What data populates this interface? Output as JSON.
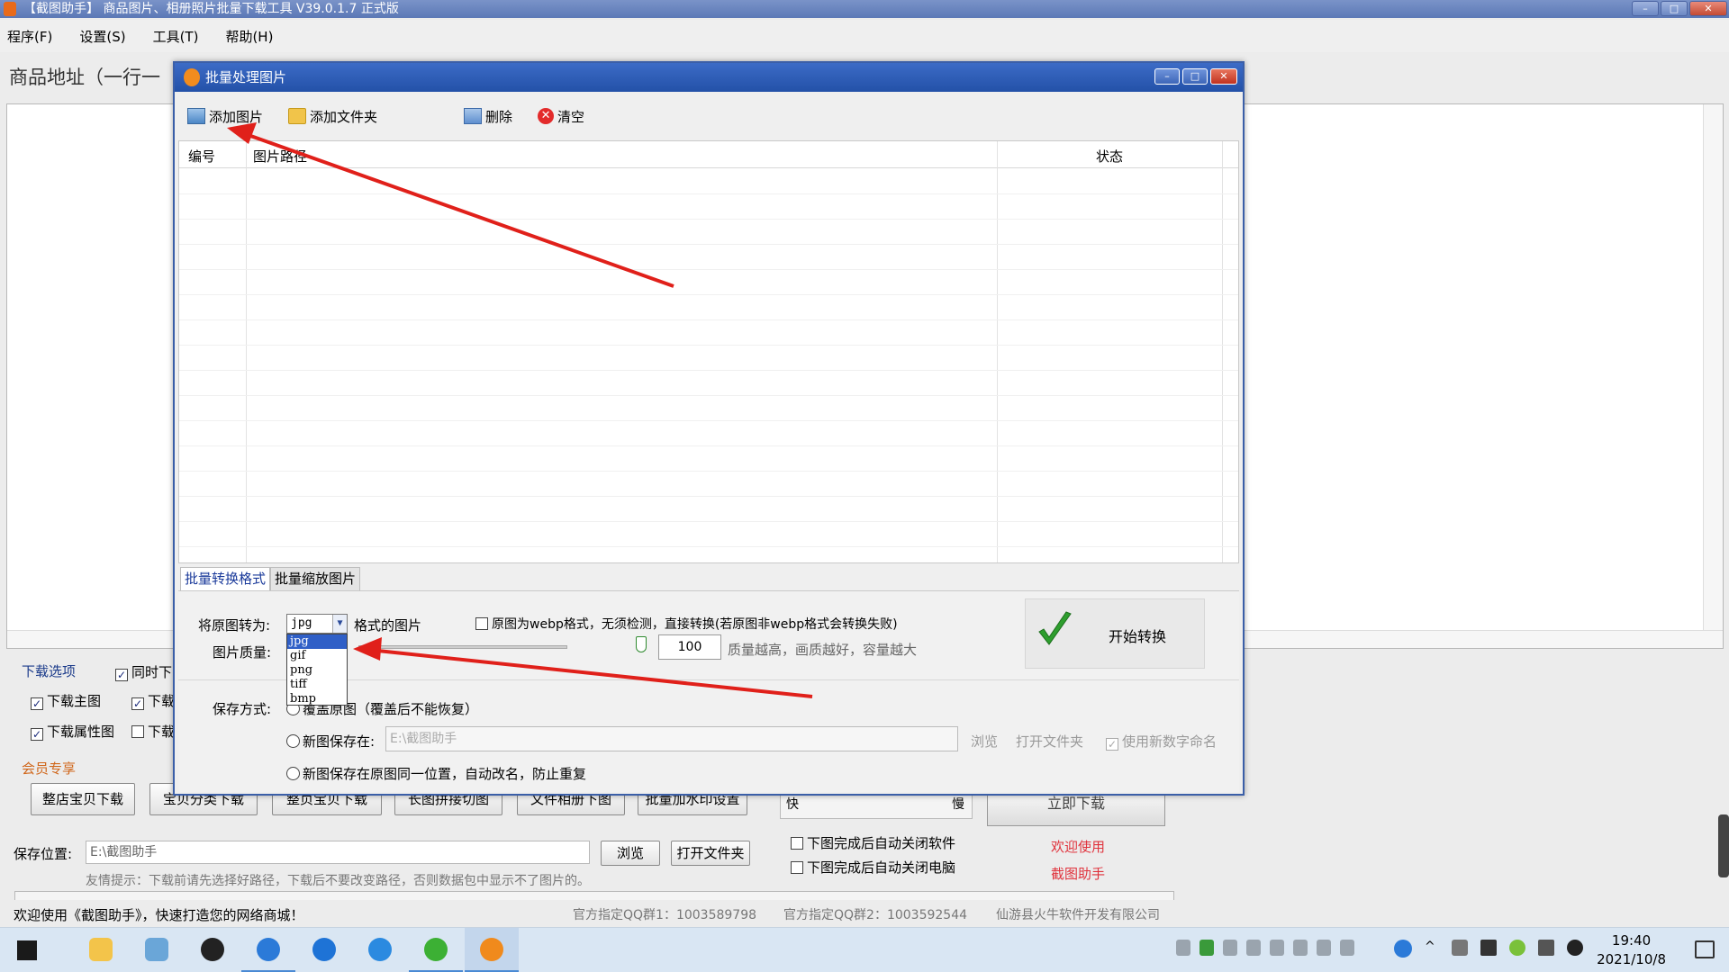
{
  "main_window": {
    "title": "【截图助手】 商品图片、相册照片批量下载工具 V39.0.1.7 正式版",
    "menu": [
      "程序(F)",
      "设置(S)",
      "工具(T)",
      "帮助(H)"
    ],
    "url_label": "商品地址（一行一",
    "download_options_label": "下载选项",
    "download_opts_hidden": "同时下",
    "opt_main": "下载主图",
    "opt_second": "下载",
    "opt_attr": "下载属性图",
    "opt_fourth": "下载",
    "member_label": "会员专享",
    "member_buttons": [
      "整店宝贝下载",
      "宝贝分类下载",
      "整页宝贝下载",
      "长图拼接切图",
      "文件相册下图",
      "批量加水印设置"
    ],
    "speed_fast": "快",
    "speed_slow": "慢",
    "download_now": "立即下载",
    "close_software": "下图完成后自动关闭软件",
    "close_pc": "下图完成后自动关闭电脑",
    "welcome_line1": "欢迎使用",
    "welcome_line2": "截图助手",
    "save_label": "保存位置:",
    "save_path": "E:\\截图助手",
    "browse": "浏览",
    "open_folder": "打开文件夹",
    "hint": "友情提示：下载前请先选择好路径，下载后不要改变路径，否则数据包中显示不了图片的。",
    "status_welcome": "欢迎使用《截图助手》，快速打造您的网络商城！",
    "qq_group1": "官方指定QQ群1：1003589798",
    "qq_group2": "官方指定QQ群2：1003592544",
    "company": "仙游县火牛软件开发有限公司"
  },
  "dialog": {
    "title": "批量处理图片",
    "toolbar": {
      "add_image": "添加图片",
      "add_folder": "添加文件夹",
      "delete": "删除",
      "clear": "清空"
    },
    "columns": {
      "num": "编号",
      "path": "图片路径",
      "status": "状态"
    },
    "tabs": [
      "批量转换格式",
      "批量缩放图片"
    ],
    "convert_label": "将原图转为:",
    "selected_format": "jpg",
    "format_suffix": "格式的图片",
    "format_options": [
      "jpg",
      "gif",
      "png",
      "tiff",
      "bmp"
    ],
    "webp_option": "原图为webp格式，无须检测，直接转换(若原图非webp格式会转换失败)",
    "quality_label": "图片质量:",
    "quality_value": "100",
    "quality_hint": "质量越高，画质越好，容量越大",
    "start_button": "开始转换",
    "save_mode_label": "保存方式:",
    "save_overwrite": "覆盖原图（覆盖后不能恢复）",
    "save_new_dir": "新图保存在:",
    "new_dir_path": "E:\\截图助手",
    "browse": "浏览",
    "open_folder": "打开文件夹",
    "use_new_name": "使用新数字命名",
    "save_same_place": "新图保存在原图同一位置，自动改名，防止重复"
  },
  "taskbar": {
    "time": "19:40",
    "date": "2021/10/8"
  },
  "colors": {
    "dialog_title": "#2351a8",
    "annotation_arrow": "#e0201a",
    "welcome_red": "#e0323c"
  }
}
